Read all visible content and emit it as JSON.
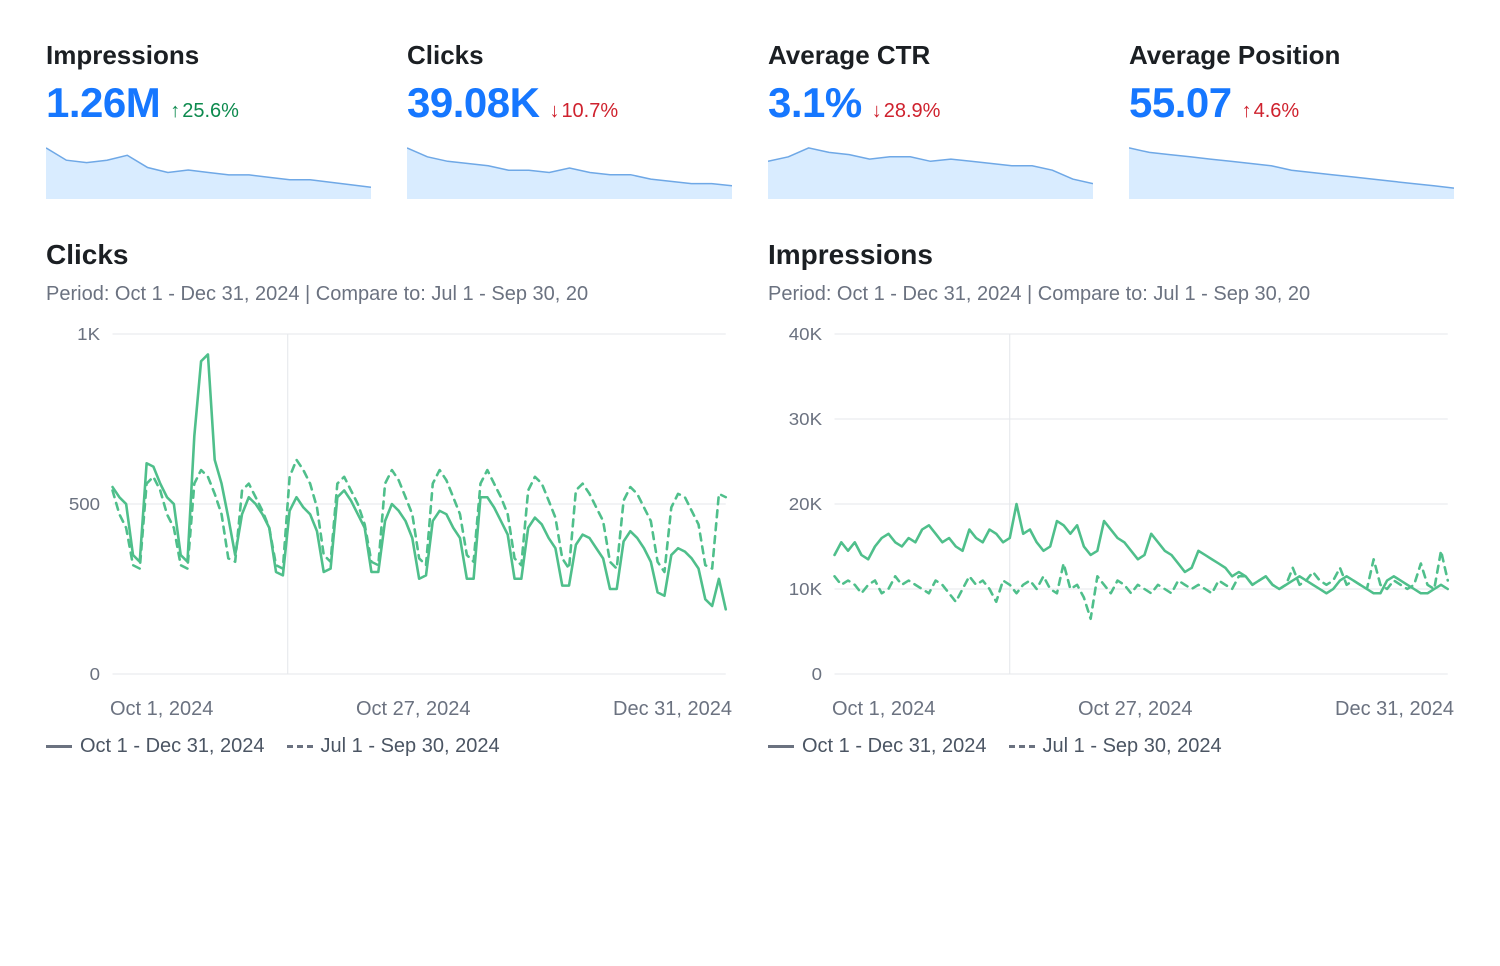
{
  "kpis": [
    {
      "title": "Impressions",
      "value": "1.26M",
      "delta": "25.6%",
      "dir": "up"
    },
    {
      "title": "Clicks",
      "value": "39.08K",
      "delta": "10.7%",
      "dir": "down"
    },
    {
      "title": "Average CTR",
      "value": "3.1%",
      "delta": "28.9%",
      "dir": "down"
    },
    {
      "title": "Average Position",
      "value": "55.07",
      "delta": "4.6%",
      "dir": "up-red"
    }
  ],
  "period_text": "Period: Oct 1 - Dec 31, 2024 | Compare to: Jul 1 - Sep 30, 20",
  "xaxis_labels": {
    "start": "Oct 1, 2024",
    "mid": "Oct 27, 2024",
    "end": "Dec 31, 2024"
  },
  "legend": {
    "current": "Oct 1 - Dec 31, 2024",
    "previous": "Jul 1 - Sep 30, 2024"
  },
  "chart_data": [
    {
      "type": "line",
      "title": "Clicks",
      "ylabel": "",
      "xlabel": "",
      "ylim": [
        0,
        1000
      ],
      "yticks": [
        0,
        500,
        1000
      ],
      "ytick_labels": [
        "0",
        "500",
        "1K"
      ],
      "x_range_days": 92,
      "x_marker_day": 26,
      "series": [
        {
          "name": "Oct 1 - Dec 31, 2024",
          "style": "solid",
          "values": [
            550,
            520,
            500,
            350,
            330,
            620,
            610,
            560,
            520,
            500,
            350,
            330,
            700,
            920,
            940,
            630,
            560,
            460,
            350,
            470,
            520,
            500,
            470,
            430,
            300,
            290,
            480,
            520,
            490,
            470,
            420,
            300,
            310,
            520,
            540,
            510,
            470,
            430,
            300,
            300,
            450,
            500,
            480,
            450,
            400,
            280,
            290,
            450,
            480,
            470,
            430,
            400,
            280,
            280,
            520,
            520,
            490,
            450,
            410,
            280,
            280,
            430,
            460,
            440,
            400,
            370,
            260,
            260,
            380,
            410,
            400,
            370,
            340,
            250,
            250,
            390,
            420,
            400,
            370,
            330,
            240,
            230,
            350,
            370,
            360,
            340,
            310,
            220,
            200,
            280,
            190
          ]
        },
        {
          "name": "Jul 1 - Sep 30, 2024",
          "style": "dashed",
          "values": [
            540,
            470,
            430,
            320,
            310,
            560,
            580,
            540,
            470,
            430,
            320,
            310,
            560,
            600,
            580,
            530,
            470,
            340,
            330,
            540,
            560,
            520,
            480,
            430,
            320,
            310,
            580,
            630,
            600,
            560,
            490,
            350,
            330,
            560,
            580,
            540,
            500,
            440,
            330,
            320,
            560,
            600,
            570,
            520,
            470,
            340,
            320,
            560,
            600,
            570,
            520,
            470,
            350,
            330,
            560,
            600,
            560,
            520,
            470,
            340,
            320,
            540,
            580,
            560,
            510,
            460,
            340,
            310,
            540,
            560,
            530,
            490,
            450,
            330,
            310,
            510,
            550,
            530,
            490,
            450,
            330,
            300,
            490,
            530,
            520,
            480,
            440,
            320,
            310,
            530,
            520
          ]
        }
      ]
    },
    {
      "type": "line",
      "title": "Impressions",
      "ylabel": "",
      "xlabel": "",
      "ylim": [
        0,
        40000
      ],
      "yticks": [
        0,
        10000,
        20000,
        30000,
        40000
      ],
      "ytick_labels": [
        "0",
        "10K",
        "20K",
        "30K",
        "40K"
      ],
      "x_range_days": 92,
      "x_marker_day": 26,
      "series": [
        {
          "name": "Oct 1 - Dec 31, 2024",
          "style": "solid",
          "values": [
            14000,
            15500,
            14500,
            15500,
            14000,
            13500,
            15000,
            16000,
            16500,
            15500,
            15000,
            16000,
            15500,
            17000,
            17500,
            16500,
            15500,
            16000,
            15000,
            14500,
            17000,
            16000,
            15500,
            17000,
            16500,
            15500,
            16000,
            20000,
            16500,
            17000,
            15500,
            14500,
            15000,
            18000,
            17500,
            16500,
            17500,
            15000,
            14000,
            14500,
            18000,
            17000,
            16000,
            15500,
            14500,
            13500,
            14000,
            16500,
            15500,
            14500,
            14000,
            13000,
            12000,
            12500,
            14500,
            14000,
            13500,
            13000,
            12500,
            11500,
            12000,
            11500,
            10500,
            11000,
            11500,
            10500,
            10000,
            10500,
            11000,
            11500,
            11000,
            10500,
            10000,
            9500,
            10000,
            11000,
            11500,
            11000,
            10500,
            10000,
            9500,
            9500,
            11000,
            11500,
            11000,
            10500,
            10000,
            9500,
            9500,
            10000,
            10500,
            10000
          ]
        },
        {
          "name": "Jul 1 - Sep 30, 2024",
          "style": "dashed",
          "values": [
            11500,
            10500,
            11000,
            10500,
            9500,
            10500,
            11000,
            9500,
            10000,
            11500,
            10500,
            11000,
            10500,
            10000,
            9500,
            11000,
            10500,
            9500,
            8500,
            10000,
            11500,
            10500,
            11000,
            10000,
            8500,
            11000,
            10500,
            9500,
            10500,
            11000,
            10000,
            11500,
            10000,
            9500,
            13000,
            10000,
            10500,
            9000,
            6500,
            11500,
            10500,
            9500,
            11000,
            10500,
            9500,
            10500,
            10000,
            9500,
            10500,
            10000,
            9500,
            11000,
            10500,
            10000,
            10500,
            10000,
            9500,
            11000,
            10500,
            10000,
            11500,
            11500,
            10500,
            11000,
            11500,
            10500,
            10000,
            10500,
            12500,
            10500,
            11000,
            12000,
            11000,
            10500,
            11000,
            12500,
            10500,
            11000,
            10500,
            10000,
            13500,
            10500,
            10000,
            11000,
            10500,
            10000,
            10500,
            13000,
            10500,
            10000,
            14500,
            11000
          ]
        }
      ]
    }
  ],
  "sparklines": {
    "impressions": [
      20,
      15,
      14,
      15,
      17,
      12,
      10,
      11,
      10,
      9,
      9,
      8,
      7,
      7,
      6,
      5,
      4
    ],
    "clicks": [
      22,
      18,
      16,
      15,
      14,
      12,
      12,
      11,
      13,
      11,
      10,
      10,
      8,
      7,
      6,
      6,
      5
    ],
    "ctr": [
      16,
      18,
      22,
      20,
      19,
      17,
      18,
      18,
      16,
      17,
      16,
      15,
      14,
      14,
      12,
      8,
      6
    ],
    "position": [
      22,
      20,
      19,
      18,
      17,
      16,
      15,
      14,
      12,
      11,
      10,
      9,
      8,
      7,
      6,
      5,
      4
    ]
  }
}
